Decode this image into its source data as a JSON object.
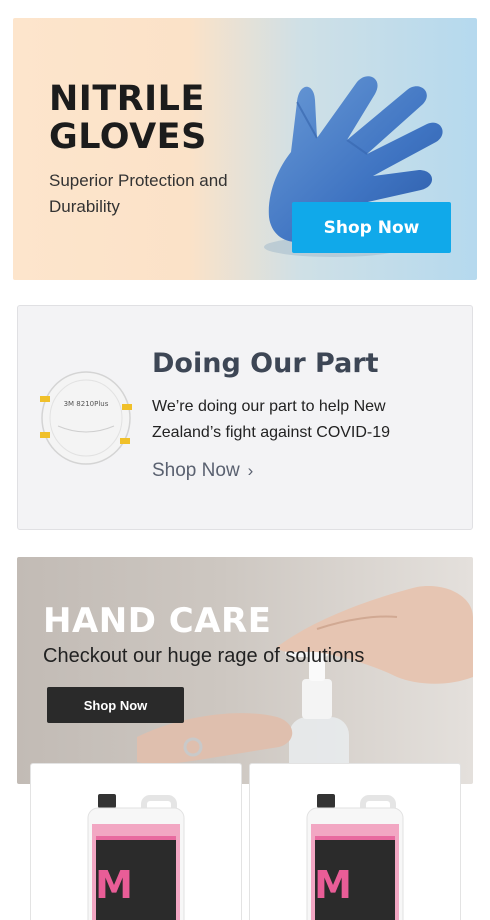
{
  "gloves_banner": {
    "title_line1": "NITRILE",
    "title_line2": "GLOVES",
    "subtitle": "Superior Protection and Durability",
    "button_label": "Shop Now",
    "button_color": "#10a9ea"
  },
  "part_banner": {
    "title": "Doing Our Part",
    "text": "We’re doing our part to help New Zealand’s fight against COVID-19",
    "link_label": "Shop Now",
    "link_icon": "chevron-right-icon",
    "mask_label": "3M 8210Plus"
  },
  "hand_banner": {
    "title": "HAND CARE",
    "subtitle": "Checkout our huge rage of solutions",
    "button_label": "Shop Now"
  },
  "products": [
    {
      "image": "pink-soap-container",
      "letter": "M"
    },
    {
      "image": "pink-soap-container",
      "letter": "M"
    }
  ]
}
